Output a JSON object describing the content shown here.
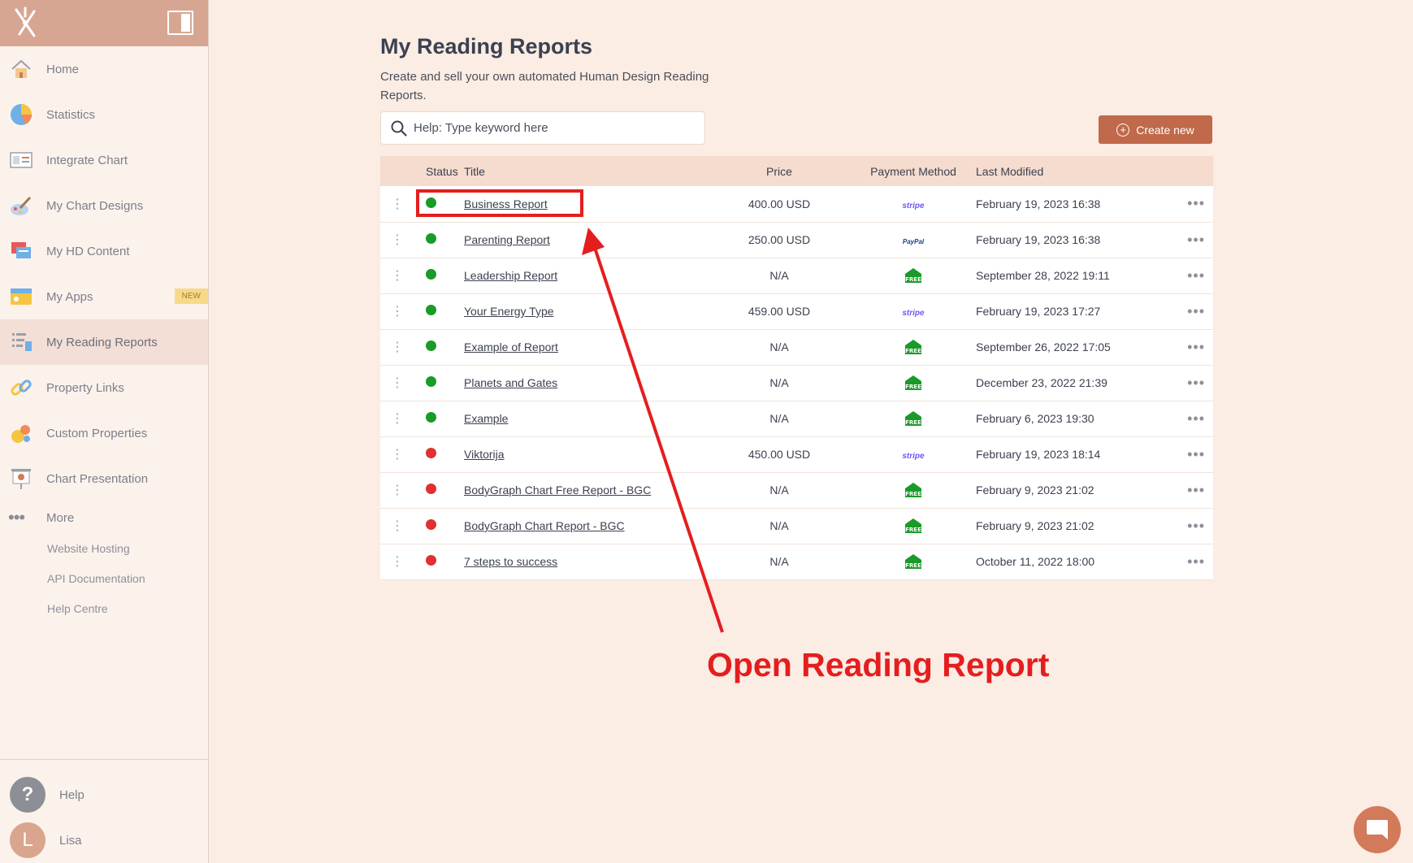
{
  "sidebar": {
    "items": [
      {
        "label": "Home",
        "icon": "home-icon"
      },
      {
        "label": "Statistics",
        "icon": "pie-chart-icon"
      },
      {
        "label": "Integrate Chart",
        "icon": "integrate-icon"
      },
      {
        "label": "My Chart Designs",
        "icon": "paint-icon"
      },
      {
        "label": "My HD Content",
        "icon": "content-icon"
      },
      {
        "label": "My Apps",
        "icon": "apps-icon",
        "badge": "NEW"
      },
      {
        "label": "My Reading Reports",
        "icon": "reports-icon",
        "active": true
      },
      {
        "label": "Property Links",
        "icon": "link-icon"
      },
      {
        "label": "Custom Properties",
        "icon": "properties-icon"
      },
      {
        "label": "Chart Presentation",
        "icon": "presentation-icon"
      }
    ],
    "more_label": "More",
    "sub_links": [
      "Website Hosting",
      "API Documentation",
      "Help Centre"
    ],
    "help_label": "Help",
    "help_symbol": "?",
    "user_name": "Lisa",
    "user_initial": "L"
  },
  "header": {
    "title": "My Reading Reports",
    "subtitle": "Create and sell your own automated Human Design Reading Reports.",
    "search_placeholder": "Help: Type keyword here",
    "create_label": "Create new"
  },
  "table": {
    "columns": [
      "Status",
      "Title",
      "Price",
      "Payment Method",
      "Last Modified"
    ],
    "rows": [
      {
        "status": "green",
        "title": "Business Report",
        "price": "400.00 USD",
        "payment": "stripe",
        "modified": "February 19, 2023 16:38"
      },
      {
        "status": "green",
        "title": "Parenting Report",
        "price": "250.00 USD",
        "payment": "paypal",
        "modified": "February 19, 2023 16:38"
      },
      {
        "status": "green",
        "title": "Leadership Report",
        "price": "N/A",
        "payment": "free",
        "modified": "September 28, 2022 19:11"
      },
      {
        "status": "green",
        "title": "Your Energy Type",
        "price": "459.00 USD",
        "payment": "stripe",
        "modified": "February 19, 2023 17:27"
      },
      {
        "status": "green",
        "title": "Example of Report",
        "price": "N/A",
        "payment": "free",
        "modified": "September 26, 2022 17:05"
      },
      {
        "status": "green",
        "title": "Planets and Gates",
        "price": "N/A",
        "payment": "free",
        "modified": "December 23, 2022 21:39"
      },
      {
        "status": "green",
        "title": "Example",
        "price": "N/A",
        "payment": "free",
        "modified": "February 6, 2023 19:30"
      },
      {
        "status": "red",
        "title": "Viktorija",
        "price": "450.00 USD",
        "payment": "stripe",
        "modified": "February 19, 2023 18:14"
      },
      {
        "status": "red",
        "title": "BodyGraph Chart Free Report - BGC",
        "price": "N/A",
        "payment": "free",
        "modified": "February 9, 2023 21:02"
      },
      {
        "status": "red",
        "title": "BodyGraph Chart Report - BGC",
        "price": "N/A",
        "payment": "free",
        "modified": "February 9, 2023 21:02"
      },
      {
        "status": "red",
        "title": "7 steps to success",
        "price": "N/A",
        "payment": "free",
        "modified": "October 11, 2022 18:00"
      }
    ]
  },
  "payment_labels": {
    "stripe": "stripe",
    "paypal": "PayPal",
    "free": "FREE"
  },
  "annotation": {
    "text": "Open Reading Report"
  },
  "colors": {
    "accent": "#c0694b",
    "annotation": "#e41e1e",
    "status_green": "#1a9a28",
    "status_red": "#e03030",
    "background": "#fbece4"
  }
}
